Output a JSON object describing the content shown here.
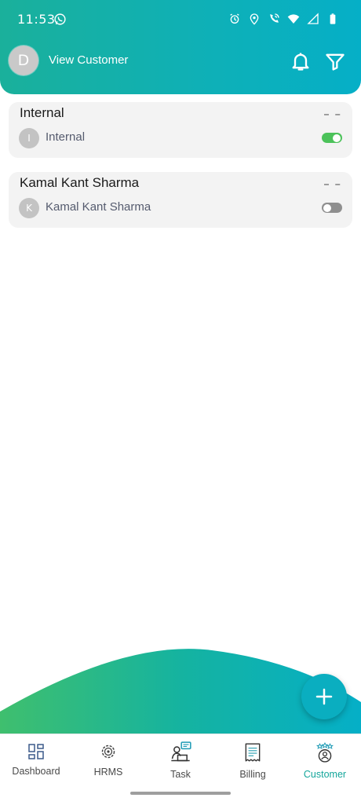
{
  "status_bar": {
    "time": "11:53",
    "icons": [
      "whatsapp-icon",
      "alarm-icon",
      "location-icon",
      "wifi-call-icon",
      "wifi-icon",
      "signal-icon",
      "battery-icon"
    ]
  },
  "header": {
    "avatar_letter": "D",
    "title": "View Customer",
    "icons": [
      "bell-icon",
      "filter-icon"
    ]
  },
  "customers": [
    {
      "title": "Internal",
      "dash": "– –",
      "avatar_letter": "I",
      "name": "Internal",
      "active": true
    },
    {
      "title": "Kamal Kant Sharma",
      "dash": "– –",
      "avatar_letter": "K",
      "name": "Kamal Kant Sharma",
      "active": false
    }
  ],
  "fab": {
    "icon": "plus-icon"
  },
  "bottom_nav": {
    "items": [
      {
        "label": "Dashboard",
        "icon": "dashboard-icon",
        "active": false
      },
      {
        "label": "HRMS",
        "icon": "hrms-gear-icon",
        "active": false
      },
      {
        "label": "Task",
        "icon": "task-icon",
        "active": false
      },
      {
        "label": "Billing",
        "icon": "billing-receipt-icon",
        "active": false
      },
      {
        "label": "Customer",
        "icon": "customer-icon",
        "active": true
      }
    ]
  },
  "colors": {
    "header_gradient_start": "#1ab09b",
    "header_gradient_end": "#05afc7",
    "toggle_on": "#4cc25a",
    "toggle_off": "#8f8f8f",
    "active_nav": "#14a69b",
    "fab": "#0aaec0"
  }
}
